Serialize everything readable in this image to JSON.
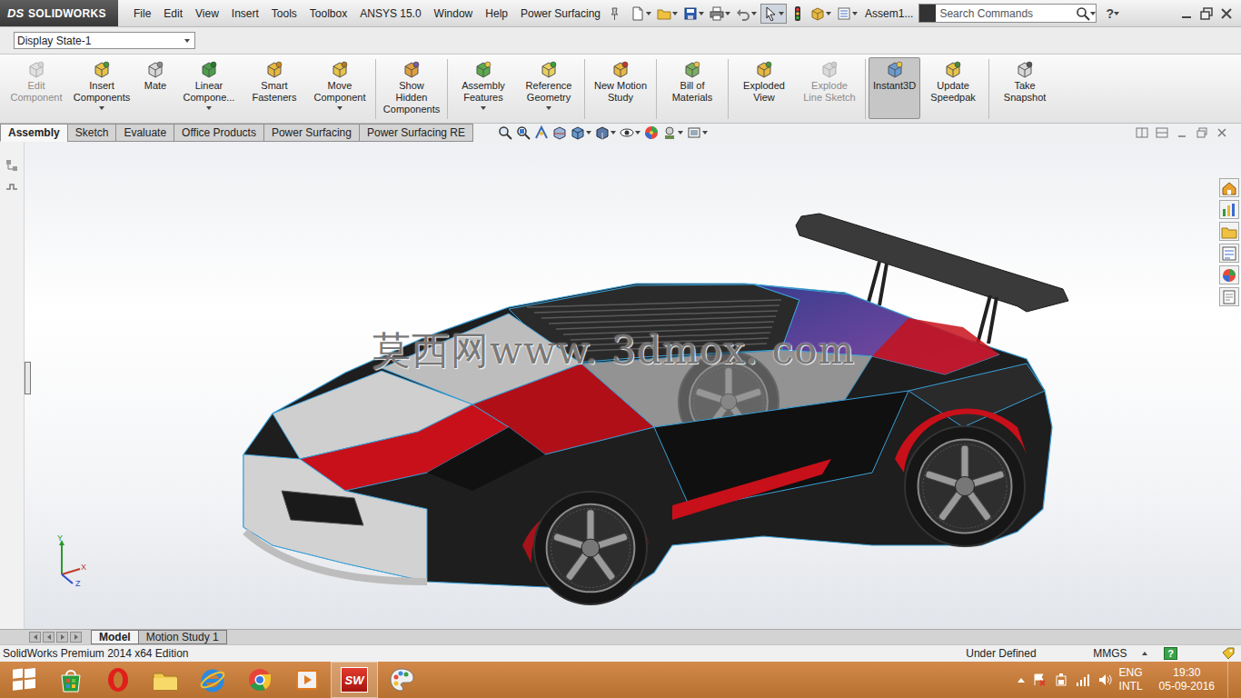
{
  "title_bar": {
    "logo_mark": "DS",
    "logo_text": "SOLIDWORKS",
    "menus": [
      "File",
      "Edit",
      "View",
      "Insert",
      "Tools",
      "Toolbox",
      "ANSYS 15.0",
      "Window",
      "Help",
      "Power Surfacing"
    ],
    "document": "Assem1...",
    "search": {
      "placeholder": "Search Commands"
    },
    "help": "?"
  },
  "display_state": "Display State-1",
  "commands": [
    {
      "label": "Edit Component",
      "disabled": true,
      "selected": false,
      "dropdown": false,
      "separator_after": false
    },
    {
      "label": "Insert Components",
      "disabled": false,
      "selected": false,
      "dropdown": true,
      "separator_after": false
    },
    {
      "label": "Mate",
      "disabled": false,
      "selected": false,
      "dropdown": false,
      "separator_after": false
    },
    {
      "label": "Linear Compone...",
      "disabled": false,
      "selected": false,
      "dropdown": true,
      "separator_after": false
    },
    {
      "label": "Smart Fasteners",
      "disabled": false,
      "selected": false,
      "dropdown": false,
      "separator_after": false
    },
    {
      "label": "Move Component",
      "disabled": false,
      "selected": false,
      "dropdown": true,
      "separator_after": true
    },
    {
      "label": "Show Hidden Components",
      "disabled": false,
      "selected": false,
      "dropdown": false,
      "separator_after": true
    },
    {
      "label": "Assembly Features",
      "disabled": false,
      "selected": false,
      "dropdown": true,
      "separator_after": false
    },
    {
      "label": "Reference Geometry",
      "disabled": false,
      "selected": false,
      "dropdown": true,
      "separator_after": true
    },
    {
      "label": "New Motion Study",
      "disabled": false,
      "selected": false,
      "dropdown": false,
      "separator_after": true
    },
    {
      "label": "Bill of Materials",
      "disabled": false,
      "selected": false,
      "dropdown": false,
      "separator_after": true
    },
    {
      "label": "Exploded View",
      "disabled": false,
      "selected": false,
      "dropdown": false,
      "separator_after": false
    },
    {
      "label": "Explode Line Sketch",
      "disabled": true,
      "selected": false,
      "dropdown": false,
      "separator_after": true
    },
    {
      "label": "Instant3D",
      "disabled": false,
      "selected": true,
      "dropdown": false,
      "separator_after": false
    },
    {
      "label": "Update Speedpak",
      "disabled": false,
      "selected": false,
      "dropdown": false,
      "separator_after": true
    },
    {
      "label": "Take Snapshot",
      "disabled": false,
      "selected": false,
      "dropdown": false,
      "separator_after": false
    }
  ],
  "tabs": [
    {
      "label": "Assembly",
      "selected": true
    },
    {
      "label": "Sketch",
      "selected": false
    },
    {
      "label": "Evaluate",
      "selected": false
    },
    {
      "label": "Office Products",
      "selected": false
    },
    {
      "label": "Power Surfacing",
      "selected": false
    },
    {
      "label": "Power Surfacing RE",
      "selected": false
    }
  ],
  "graphics": {
    "watermark": "莫西网www. 3dmox. com",
    "triad": {
      "x": "X",
      "y": "Y",
      "z": "Z"
    }
  },
  "model_tabs": [
    {
      "label": "Model",
      "selected": true
    },
    {
      "label": "Motion Study 1",
      "selected": false
    }
  ],
  "status_bar": {
    "edition": "SolidWorks Premium 2014 x64 Edition",
    "state": "Under Defined",
    "units": "MMGS",
    "help": "?"
  },
  "taskbar": {
    "apps": [
      {
        "kind": "start",
        "active": false
      },
      {
        "kind": "store",
        "active": false
      },
      {
        "kind": "opera",
        "active": false
      },
      {
        "kind": "explorer",
        "active": false
      },
      {
        "kind": "ie",
        "active": false
      },
      {
        "kind": "chrome",
        "active": false
      },
      {
        "kind": "media",
        "active": false
      },
      {
        "kind": "solidworks",
        "active": true,
        "label": "SW"
      },
      {
        "kind": "paint",
        "active": false
      }
    ],
    "language": "ENG",
    "layout": "INTL",
    "time": "19:30",
    "date": "05-09-2016"
  }
}
